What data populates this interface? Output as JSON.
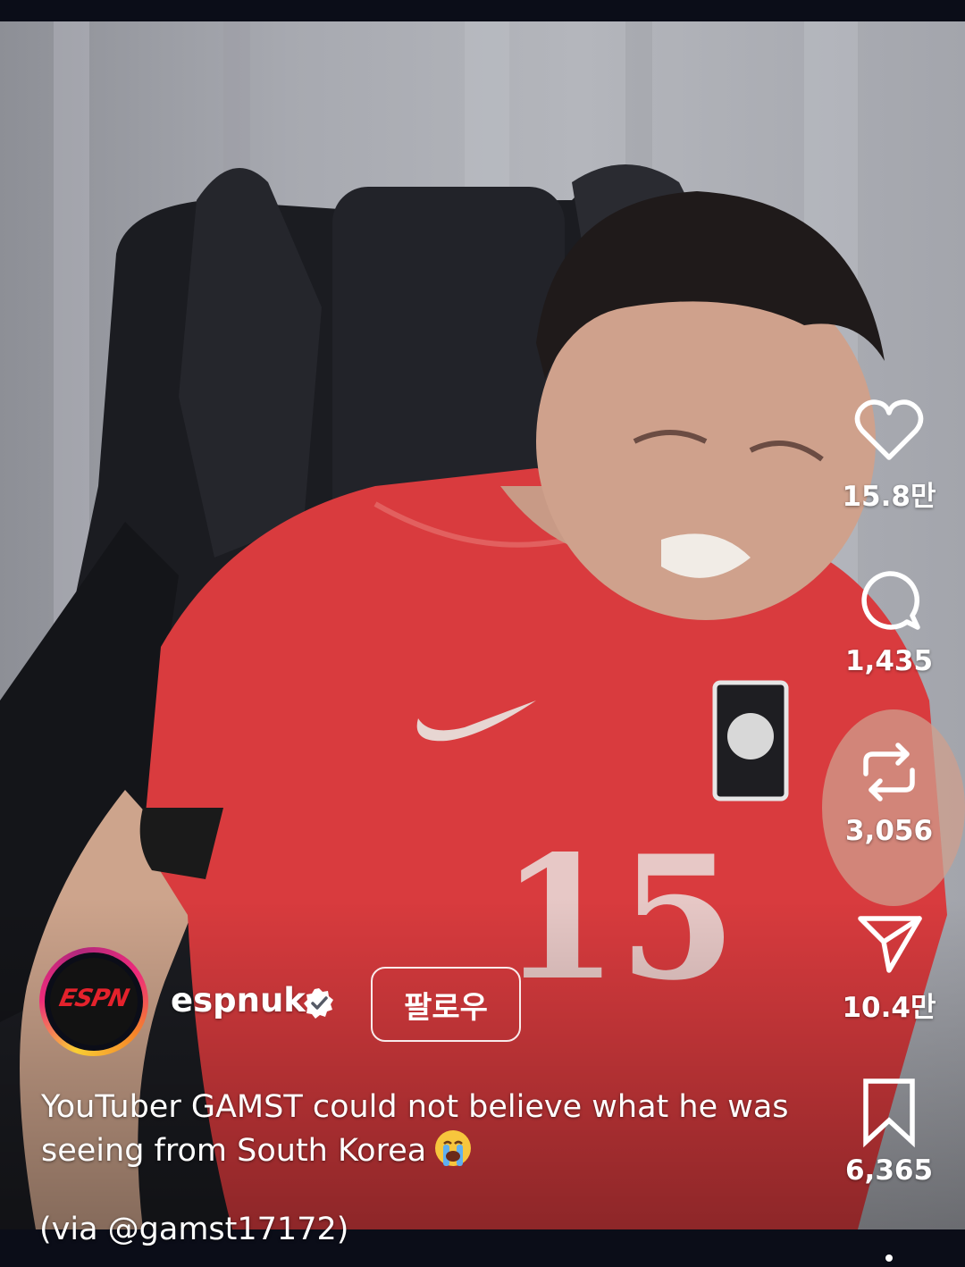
{
  "post": {
    "author": {
      "username": "espnuk",
      "avatar_logo_text": "ESPN",
      "verified": true,
      "follow_label": "팔로우"
    },
    "caption": {
      "line1": "YouTuber GAMST could not believe what he was",
      "line2": "seeing from South Korea",
      "emoji": "loudly-crying-face",
      "via_prefix": "(via ",
      "via_handle": "gamst17172",
      "via_suffix": ")"
    }
  },
  "actions": {
    "like": {
      "icon": "heart-icon",
      "count": "15.8만"
    },
    "comment": {
      "icon": "comment-bubble-icon",
      "count": "1,435"
    },
    "repost": {
      "icon": "repost-icon",
      "count": "3,056"
    },
    "share": {
      "icon": "send-icon",
      "count": "10.4만"
    },
    "save": {
      "icon": "bookmark-icon",
      "count": "6,365"
    }
  },
  "colors": {
    "background": "#0b0d18",
    "jersey": "#d93b3e",
    "espn_red": "#e4222c",
    "avatar_ring": [
      "#f9ce34",
      "#ee2a7b",
      "#f58529"
    ]
  }
}
